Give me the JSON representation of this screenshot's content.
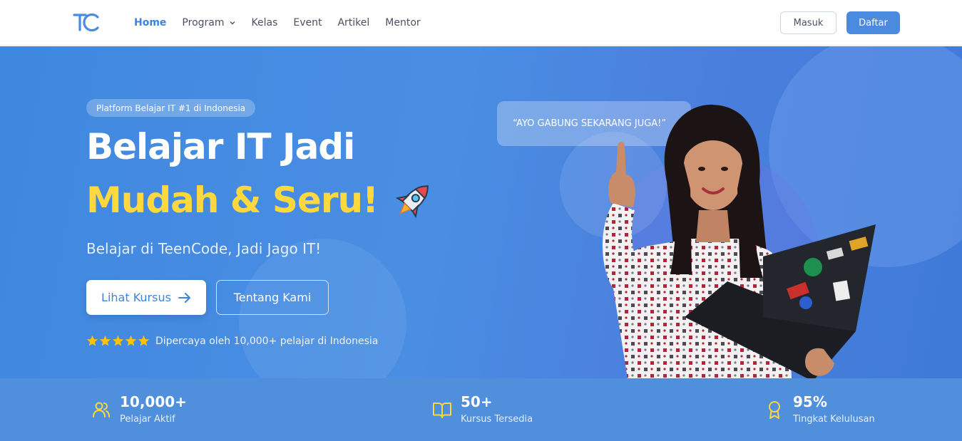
{
  "nav": {
    "logo_text": "TC",
    "links": [
      {
        "label": "Home",
        "active": true
      },
      {
        "label": "Program",
        "dropdown": true
      },
      {
        "label": "Kelas"
      },
      {
        "label": "Event"
      },
      {
        "label": "Artikel"
      },
      {
        "label": "Mentor"
      }
    ],
    "login_label": "Masuk",
    "register_label": "Daftar"
  },
  "hero": {
    "badge": "Platform Belajar IT #1 di Indonesia",
    "title_line1": "Belajar IT Jadi",
    "title_line2": "Mudah & Seru!",
    "subtitle": "Belajar di TeenCode, Jadi Jago IT!",
    "primary_button": "Lihat Kursus",
    "secondary_button": "Tentang Kami",
    "rating_stars": 5,
    "trust_text": "Dipercaya oleh 10,000+ pelajar di Indonesia",
    "speech_bubble": "“AYO GABUNG SEKARANG JUGA!”"
  },
  "stats": [
    {
      "icon": "users-icon",
      "value": "10,000+",
      "label": "Pelajar Aktif"
    },
    {
      "icon": "book-icon",
      "value": "50+",
      "label": "Kursus Tersedia"
    },
    {
      "icon": "award-icon",
      "value": "95%",
      "label": "Tingkat Kelulusan"
    }
  ],
  "colors": {
    "brand": "#3d84db",
    "hero_bg": "#4a8ee3",
    "accent_yellow": "#ffd83d",
    "stat_icon": "#ffd83d"
  }
}
